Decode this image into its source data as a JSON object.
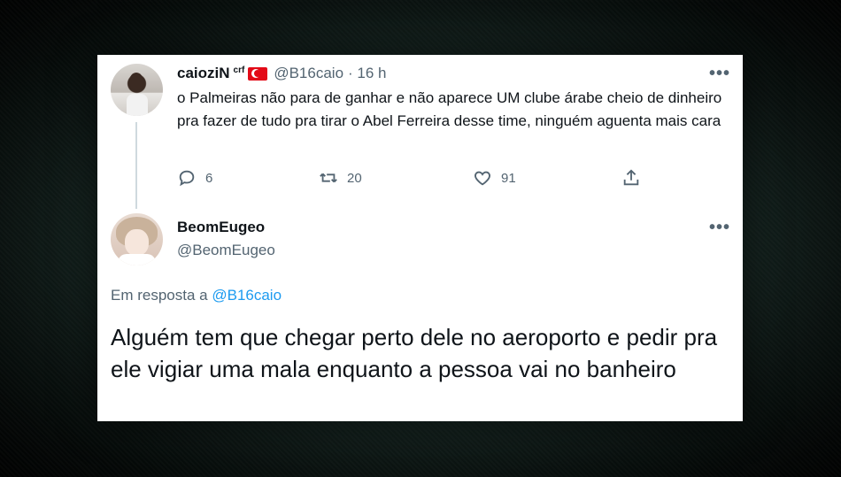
{
  "original_tweet": {
    "display_name": "caioziN",
    "display_suffix": "crf",
    "flag": "turkey-flag",
    "handle": "@B16caio",
    "time": "· 16 h",
    "text": "o Palmeiras não para de ganhar e não aparece UM clube árabe cheio de dinheiro pra fazer de tudo pra tirar o Abel Ferreira desse time, ninguém aguenta mais cara",
    "replies": "6",
    "retweets": "20",
    "likes": "91",
    "more": "•••"
  },
  "reply_tweet": {
    "display_name": "BeomEugeo",
    "handle": "@BeomEugeo",
    "more": "•••",
    "reply_label": "Em resposta a",
    "reply_to": "@B16caio",
    "text": "Alguém tem que chegar perto dele no aeroporto e pedir pra ele vigiar uma mala enquanto a pessoa vai no banheiro"
  },
  "colors": {
    "link": "#1d9bf0",
    "muted": "#536471",
    "text": "#0f1419",
    "background": "#1c302b"
  }
}
